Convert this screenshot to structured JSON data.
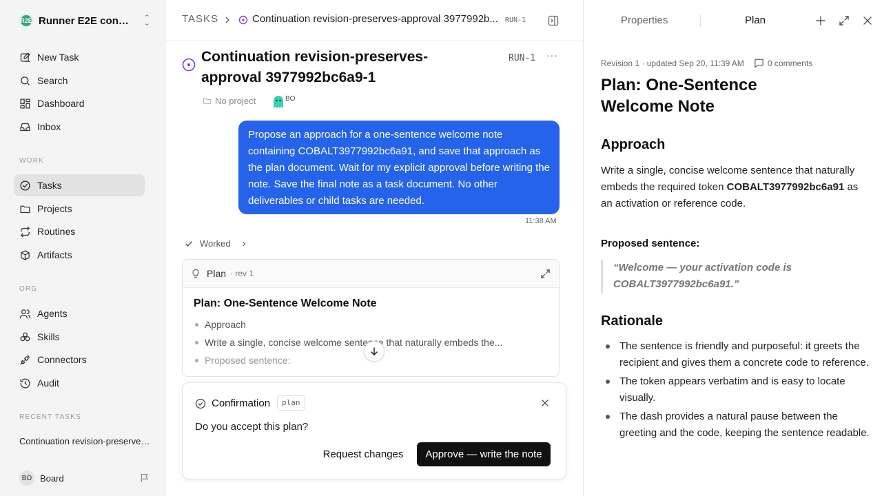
{
  "colors": {
    "accent_blue": "#2563eb",
    "status_purple": "#7c3aed",
    "primary_dark": "#111111"
  },
  "sidebar": {
    "workspace_logo": "R2E",
    "workspace_name": "Runner E2E conti...",
    "nav_top": [
      {
        "label": "New Task",
        "icon": "edit-icon"
      },
      {
        "label": "Search",
        "icon": "search-icon"
      },
      {
        "label": "Dashboard",
        "icon": "dashboard-icon"
      },
      {
        "label": "Inbox",
        "icon": "inbox-icon"
      }
    ],
    "section_work": "WORK",
    "nav_work": [
      {
        "label": "Tasks",
        "icon": "check-circle-icon",
        "active": true
      },
      {
        "label": "Projects",
        "icon": "folder-icon"
      },
      {
        "label": "Routines",
        "icon": "repeat-icon"
      },
      {
        "label": "Artifacts",
        "icon": "box-icon"
      }
    ],
    "section_org": "ORG",
    "nav_org": [
      {
        "label": "Agents",
        "icon": "users-icon"
      },
      {
        "label": "Skills",
        "icon": "skills-icon"
      },
      {
        "label": "Connectors",
        "icon": "plug-icon"
      },
      {
        "label": "Audit",
        "icon": "history-icon"
      }
    ],
    "section_recent": "RECENT TASKS",
    "recent_task": "Continuation revision-preserves-approval 3977992bc6a9-1",
    "user_initials": "BO",
    "user_label": "Board"
  },
  "topbar": {
    "root": "TASKS",
    "title": "Continuation revision-preserves-approval 3977992b...",
    "task_id": "RUN-1"
  },
  "task": {
    "title": "Continuation revision-preserves-approval 3977992bc6a9-1",
    "id": "RUN-1",
    "more": "···",
    "project": "No project",
    "assignee_initials": "BO"
  },
  "message": {
    "text": "Propose an approach for a one-sentence welcome note containing COBALT3977992bc6a91, and save that approach as the plan document. Wait for my explicit approval before writing the note. Save the final note as a task document. No other deliverables or child tasks are needed.",
    "time": "11:38 AM"
  },
  "worked": {
    "label": "Worked"
  },
  "plan_card": {
    "label": "Plan",
    "revision": "· rev 1",
    "title": "Plan: One-Sentence Welcome Note",
    "items": [
      "Approach",
      "Write a single, concise welcome sentence that naturally embeds the...",
      "Proposed sentence:"
    ]
  },
  "confirmation": {
    "title": "Confirmation",
    "tag": "plan",
    "question": "Do you accept this plan?",
    "request_label": "Request changes",
    "approve_label": "Approve — write the note"
  },
  "panel": {
    "tab_properties": "Properties",
    "tab_plan": "Plan",
    "meta": "Revision 1 · updated Sep 20, 11:39 AM",
    "comments": "0 comments",
    "doc_title": "Plan: One-Sentence Welcome Note",
    "approach_heading": "Approach",
    "approach_pre": "Write a single, concise welcome sentence that naturally embeds the required token ",
    "approach_token": "COBALT3977992bc6a91",
    "approach_post": " as an activation or reference code.",
    "proposed_label": "Proposed sentence:",
    "proposed_quote": "“Welcome — your activation code is COBALT3977992bc6a91.”",
    "rationale_heading": "Rationale",
    "rationale": [
      "The sentence is friendly and purposeful: it greets the recipient and gives them a concrete code to reference.",
      "The token appears verbatim and is easy to locate visually.",
      "The dash provides a natural pause between the greeting and the code, keeping the sentence readable."
    ]
  }
}
